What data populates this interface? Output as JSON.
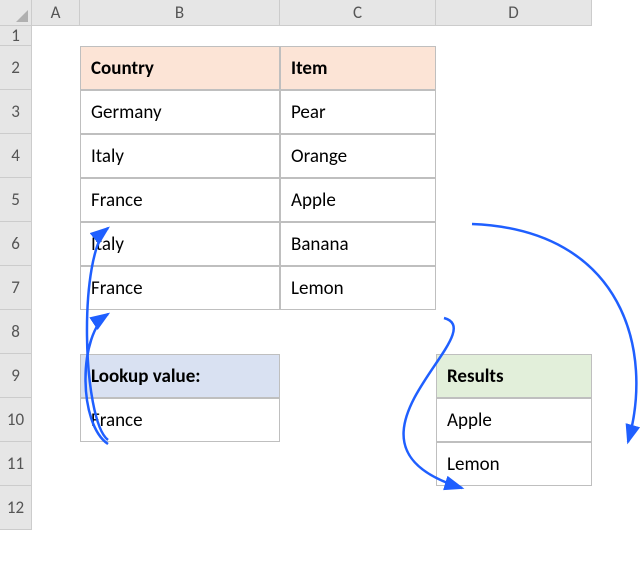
{
  "columns": {
    "A": "A",
    "B": "B",
    "C": "C",
    "D": "D"
  },
  "rows": [
    "1",
    "2",
    "3",
    "4",
    "5",
    "6",
    "7",
    "8",
    "9",
    "10",
    "11",
    "12"
  ],
  "table": {
    "headers": {
      "country": "Country",
      "item": "Item"
    },
    "rows": [
      {
        "country": "Germany",
        "item": "Pear"
      },
      {
        "country": "Italy",
        "item": "Orange"
      },
      {
        "country": "France",
        "item": "Apple"
      },
      {
        "country": "Italy",
        "item": "Banana"
      },
      {
        "country": "France",
        "item": "Lemon"
      }
    ]
  },
  "lookup": {
    "label": "Lookup value:",
    "value": "France"
  },
  "results": {
    "label": "Results",
    "values": [
      "Apple",
      "Lemon"
    ]
  },
  "colors": {
    "arrow": "#1f5fff"
  }
}
